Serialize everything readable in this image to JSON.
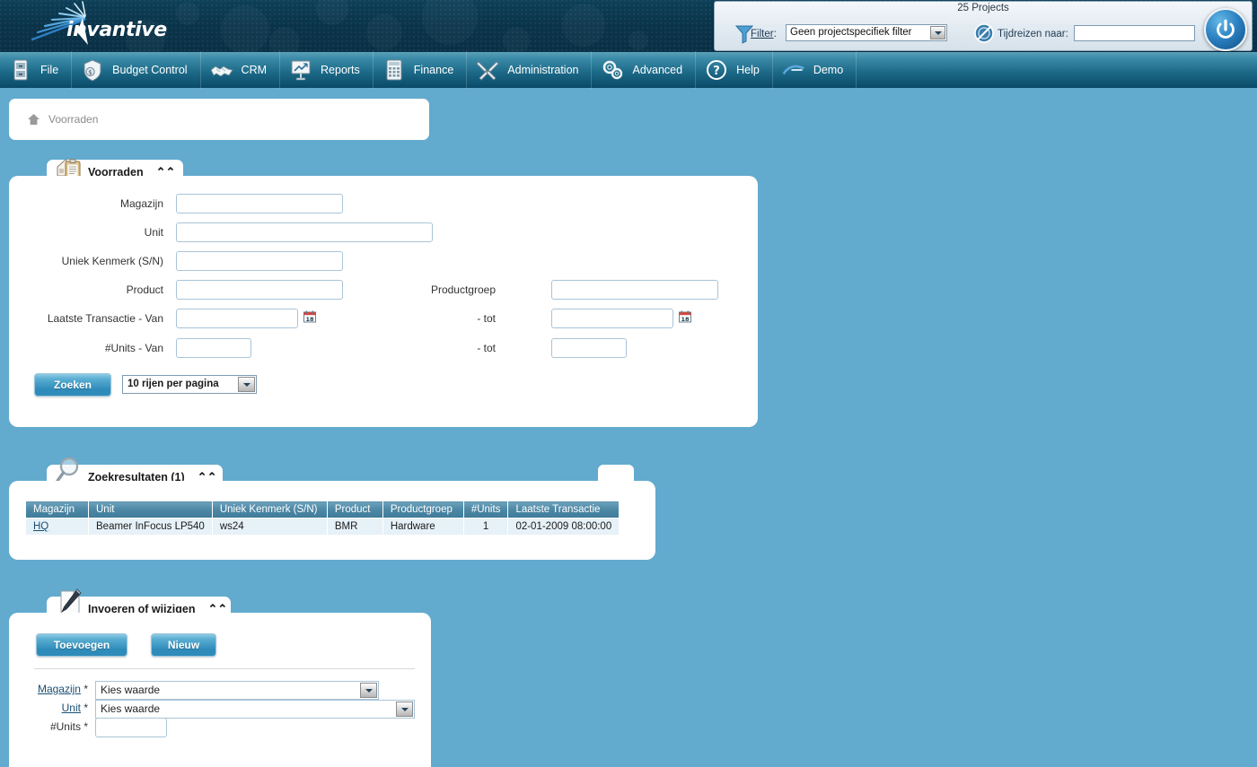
{
  "app": {
    "brand": "invantive",
    "power_icon": "power-icon"
  },
  "filterbar": {
    "title": "25 Projects",
    "funnel_icon": "funnel-icon",
    "filter_label": "Filter",
    "filter_colon": ":",
    "filter_value": "Geen projectspecifiek filter",
    "clock_icon": "time-travel-icon",
    "timetravel_label": "Tijdreizen naar:",
    "timetravel_value": ""
  },
  "menu": {
    "items": [
      {
        "label": "File",
        "icon": "cabinet-icon"
      },
      {
        "label": "Budget Control",
        "icon": "money-shield-icon"
      },
      {
        "label": "CRM",
        "icon": "handshake-icon"
      },
      {
        "label": "Reports",
        "icon": "presentation-chart-icon"
      },
      {
        "label": "Finance",
        "icon": "calculator-icon"
      },
      {
        "label": "Administration",
        "icon": "tools-icon"
      },
      {
        "label": "Advanced",
        "icon": "gears-icon"
      },
      {
        "label": "Help",
        "icon": "question-circle-icon"
      },
      {
        "label": "Demo",
        "icon": "invantive-logo-icon"
      }
    ]
  },
  "breadcrumb": {
    "home_icon": "home-icon",
    "text": "Voorraden"
  },
  "search_panel": {
    "tab_title": "Voorraden",
    "tab_icon": "clipboard-house-icon",
    "collapse_icon": "chevron-up-icon",
    "fields": {
      "magazijn_label": "Magazijn",
      "magazijn_value": "",
      "unit_label": "Unit",
      "unit_value": "",
      "uniek_label": "Uniek Kenmerk (S/N)",
      "uniek_value": "",
      "product_label": "Product",
      "product_value": "",
      "productgroep_label": "Productgroep",
      "productgroep_value": "",
      "transactie_label": "Laatste Transactie - Van",
      "transactie_van_value": "",
      "transactie_tot_label": "- tot",
      "transactie_tot_value": "",
      "units_label": "#Units - Van",
      "units_van_value": "",
      "units_tot_label": "- tot",
      "units_tot_value": ""
    },
    "search_button": "Zoeken",
    "rows_per_page": "10 rijen per pagina"
  },
  "results_panel": {
    "tab_title": "Zoekresultaten (1)",
    "tab_icon": "magnifier-icon",
    "collapse_icon": "chevron-up-icon",
    "columns": [
      "Magazijn",
      "Unit",
      "Uniek Kenmerk (S/N)",
      "Product",
      "Productgroep",
      "#Units",
      "Laatste Transactie"
    ],
    "rows": [
      {
        "magazijn": "HQ",
        "unit": "Beamer InFocus LP540",
        "uniek_kenmerk": "ws24",
        "product": "BMR",
        "productgroep": "Hardware",
        "units": "1",
        "laatste_transactie": "02-01-2009 08:00:00"
      }
    ]
  },
  "edit_panel": {
    "tab_title": "Invoeren of wijzigen",
    "tab_icon": "pencil-document-icon",
    "collapse_icon": "chevron-up-icon",
    "add_button": "Toevoegen",
    "new_button": "Nieuw",
    "magazijn_label": "Magazijn",
    "magazijn_required": "*",
    "magazijn_value": "Kies waarde",
    "unit_label": "Unit",
    "unit_required": "*",
    "unit_value": "Kies waarde",
    "units_label": "#Units",
    "units_required": "*",
    "units_value": ""
  },
  "colors": {
    "page_bg": "#62aace",
    "banner_dark": "#0a3248",
    "menu_teal": "#1b6886",
    "table_header": "#4c87a4",
    "table_row": "#e6f1f8",
    "button_blue": "#2f8cba"
  }
}
